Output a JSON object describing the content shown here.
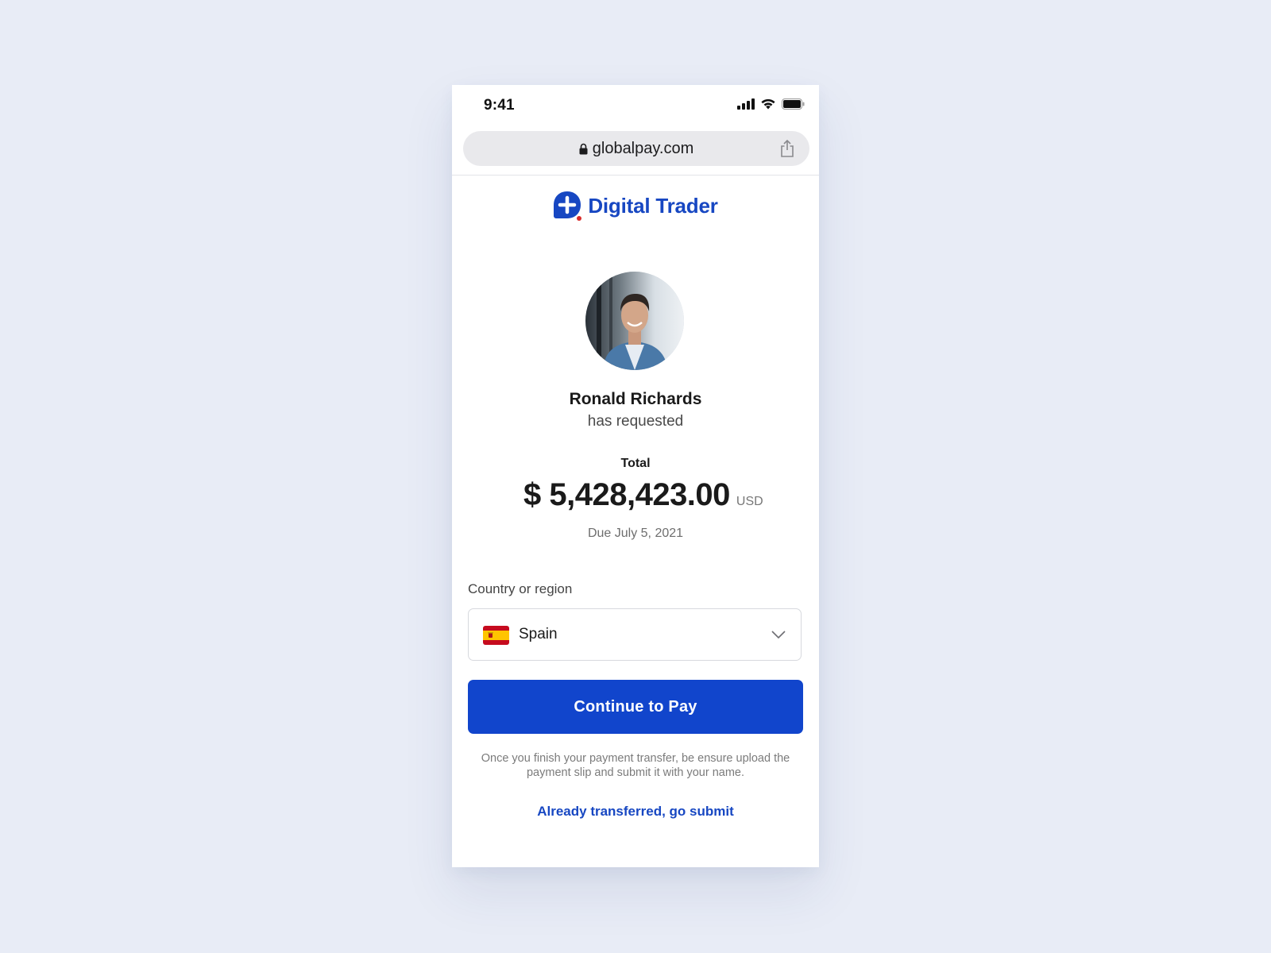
{
  "status_bar": {
    "time": "9:41",
    "icons": [
      "signal-icon",
      "wifi-icon",
      "battery-icon"
    ]
  },
  "browser": {
    "url": "globalpay.com",
    "secure_icon": "lock-icon",
    "share_icon": "share-icon"
  },
  "brand": {
    "name": "Digital Trader",
    "logo_icon": "plus-logo-icon",
    "color": "#1747c2",
    "accent_dot": "#d92b2b"
  },
  "request": {
    "requester_name": "Ronald Richards",
    "requested_text": "has requested",
    "total_label": "Total",
    "amount": "$ 5,428,423.00",
    "currency": "USD",
    "due_date": "Due July 5, 2021"
  },
  "country": {
    "label": "Country or region",
    "selected": "Spain",
    "flag_icon": "spain-flag-icon",
    "dropdown_icon": "chevron-down-icon"
  },
  "actions": {
    "pay_label": "Continue to Pay",
    "pay_color": "#1145cc",
    "note": "Once you finish your payment transfer, be ensure upload the payment slip and submit it with your name.",
    "submit_link": "Already transferred, go submit"
  }
}
